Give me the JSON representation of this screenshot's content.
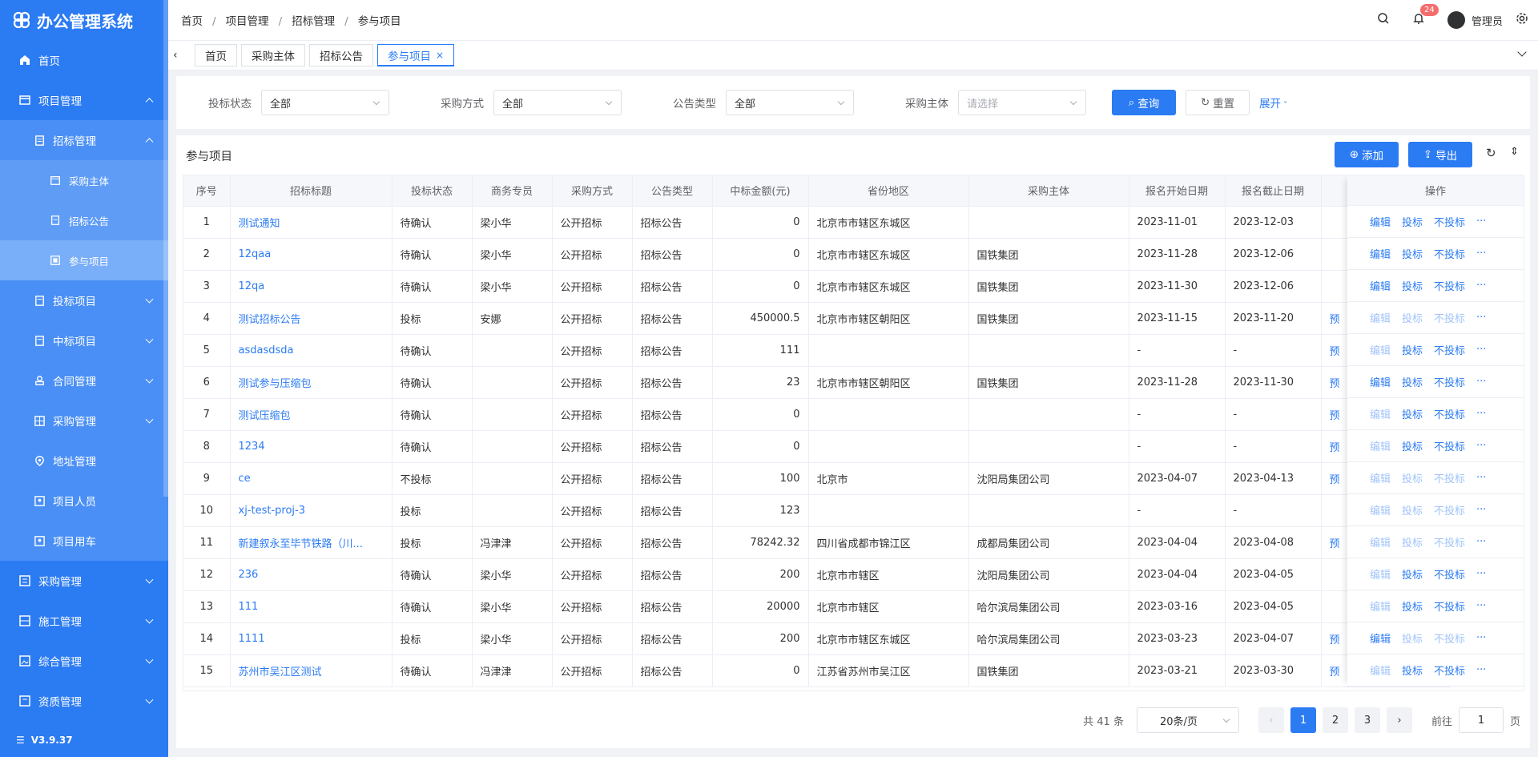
{
  "app": {
    "title": "办公管理系统",
    "version": "V3.9.37"
  },
  "sidebar": {
    "items": [
      {
        "label": "首页"
      },
      {
        "label": "项目管理"
      },
      {
        "label": "招标管理"
      },
      {
        "label": "采购主体"
      },
      {
        "label": "招标公告"
      },
      {
        "label": "参与项目"
      },
      {
        "label": "投标项目"
      },
      {
        "label": "中标项目"
      },
      {
        "label": "合同管理"
      },
      {
        "label": "采购管理"
      },
      {
        "label": "地址管理"
      },
      {
        "label": "项目人员"
      },
      {
        "label": "项目用车"
      },
      {
        "label": "采购管理"
      },
      {
        "label": "施工管理"
      },
      {
        "label": "综合管理"
      },
      {
        "label": "资质管理"
      }
    ]
  },
  "breadcrumb": [
    "首页",
    "项目管理",
    "招标管理",
    "参与项目"
  ],
  "breadcrumb_sep": "/",
  "header": {
    "notification_count": "24",
    "user": "管理员"
  },
  "tabs": [
    "首页",
    "采购主体",
    "招标公告",
    "参与项目"
  ],
  "tab_close": "×",
  "filters": [
    {
      "label": "投标状态",
      "value": "全部"
    },
    {
      "label": "采购方式",
      "value": "全部"
    },
    {
      "label": "公告类型",
      "value": "全部"
    },
    {
      "label": "采购主体",
      "placeholder": "请选择"
    }
  ],
  "buttons": {
    "query": "查询",
    "reset": "重置",
    "expand": "展开",
    "add": "添加",
    "export": "导出"
  },
  "section_title": "参与项目",
  "table": {
    "headers": [
      "序号",
      "招标标题",
      "投标状态",
      "商务专员",
      "采购方式",
      "公告类型",
      "中标金额(元)",
      "省份地区",
      "采购主体",
      "报名开始日期",
      "报名截止日期",
      ""
    ],
    "op_header": "操作",
    "hidden_col_text": "预",
    "rows": [
      {
        "no": "1",
        "title": "测试通知",
        "status": "待确认",
        "person": "梁小华",
        "method": "公开招标",
        "type": "招标公告",
        "amount": "0",
        "region": "北京市市辖区东城区",
        "buyer": "",
        "start": "2023-11-01",
        "end": "2023-12-03",
        "pre": "",
        "ops": [
          true,
          true,
          true
        ]
      },
      {
        "no": "2",
        "title": "12qaa",
        "status": "待确认",
        "person": "梁小华",
        "method": "公开招标",
        "type": "招标公告",
        "amount": "0",
        "region": "北京市市辖区东城区",
        "buyer": "国铁集团",
        "start": "2023-11-28",
        "end": "2023-12-06",
        "pre": "",
        "ops": [
          true,
          true,
          true
        ]
      },
      {
        "no": "3",
        "title": "12qa",
        "status": "待确认",
        "person": "梁小华",
        "method": "公开招标",
        "type": "招标公告",
        "amount": "0",
        "region": "北京市市辖区东城区",
        "buyer": "国铁集团",
        "start": "2023-11-30",
        "end": "2023-12-06",
        "pre": "",
        "ops": [
          true,
          true,
          true
        ]
      },
      {
        "no": "4",
        "title": "测试招标公告",
        "status": "投标",
        "person": "安娜",
        "method": "公开招标",
        "type": "招标公告",
        "amount": "450000.5",
        "region": "北京市市辖区朝阳区",
        "buyer": "国铁集团",
        "start": "2023-11-15",
        "end": "2023-11-20",
        "pre": "预",
        "ops": [
          false,
          false,
          false
        ]
      },
      {
        "no": "5",
        "title": "asdasdsda",
        "status": "待确认",
        "person": "",
        "method": "公开招标",
        "type": "招标公告",
        "amount": "111",
        "region": "",
        "buyer": "",
        "start": "-",
        "end": "-",
        "pre": "预",
        "ops": [
          false,
          true,
          true
        ]
      },
      {
        "no": "6",
        "title": "测试参与压缩包",
        "status": "待确认",
        "person": "",
        "method": "公开招标",
        "type": "招标公告",
        "amount": "23",
        "region": "北京市市辖区朝阳区",
        "buyer": "国铁集团",
        "start": "2023-11-28",
        "end": "2023-11-30",
        "pre": "预",
        "ops": [
          true,
          true,
          true
        ]
      },
      {
        "no": "7",
        "title": "测试压缩包",
        "status": "待确认",
        "person": "",
        "method": "公开招标",
        "type": "招标公告",
        "amount": "0",
        "region": "",
        "buyer": "",
        "start": "-",
        "end": "-",
        "pre": "预",
        "ops": [
          false,
          true,
          true
        ]
      },
      {
        "no": "8",
        "title": "1234",
        "status": "待确认",
        "person": "",
        "method": "公开招标",
        "type": "招标公告",
        "amount": "0",
        "region": "",
        "buyer": "",
        "start": "-",
        "end": "-",
        "pre": "预",
        "ops": [
          false,
          true,
          true
        ]
      },
      {
        "no": "9",
        "title": "ce",
        "status": "不投标",
        "person": "",
        "method": "公开招标",
        "type": "招标公告",
        "amount": "100",
        "region": "北京市",
        "buyer": "沈阳局集团公司",
        "start": "2023-04-07",
        "end": "2023-04-13",
        "pre": "预",
        "ops": [
          false,
          false,
          false
        ]
      },
      {
        "no": "10",
        "title": "xj-test-proj-3",
        "status": "投标",
        "person": "",
        "method": "公开招标",
        "type": "招标公告",
        "amount": "123",
        "region": "",
        "buyer": "",
        "start": "-",
        "end": "-",
        "pre": "",
        "ops": [
          false,
          false,
          false
        ]
      },
      {
        "no": "11",
        "title": "新建叙永至毕节铁路（川...",
        "status": "投标",
        "person": "冯津津",
        "method": "公开招标",
        "type": "招标公告",
        "amount": "78242.32",
        "region": "四川省成都市锦江区",
        "buyer": "成都局集团公司",
        "start": "2023-04-04",
        "end": "2023-04-08",
        "pre": "预",
        "ops": [
          false,
          false,
          false
        ]
      },
      {
        "no": "12",
        "title": "236",
        "status": "待确认",
        "person": "梁小华",
        "method": "公开招标",
        "type": "招标公告",
        "amount": "200",
        "region": "北京市市辖区",
        "buyer": "沈阳局集团公司",
        "start": "2023-04-04",
        "end": "2023-04-05",
        "pre": "",
        "ops": [
          false,
          true,
          true
        ]
      },
      {
        "no": "13",
        "title": "111",
        "status": "待确认",
        "person": "梁小华",
        "method": "公开招标",
        "type": "招标公告",
        "amount": "20000",
        "region": "北京市市辖区",
        "buyer": "哈尔滨局集团公司",
        "start": "2023-03-16",
        "end": "2023-04-05",
        "pre": "",
        "ops": [
          false,
          true,
          true
        ]
      },
      {
        "no": "14",
        "title": "1111",
        "status": "投标",
        "person": "梁小华",
        "method": "公开招标",
        "type": "招标公告",
        "amount": "200",
        "region": "北京市市辖区东城区",
        "buyer": "哈尔滨局集团公司",
        "start": "2023-03-23",
        "end": "2023-04-07",
        "pre": "预",
        "ops": [
          true,
          false,
          false
        ]
      },
      {
        "no": "15",
        "title": "苏州市吴江区测试",
        "status": "待确认",
        "person": "冯津津",
        "method": "公开招标",
        "type": "招标公告",
        "amount": "0",
        "region": "江苏省苏州市吴江区",
        "buyer": "国铁集团",
        "start": "2023-03-21",
        "end": "2023-03-30",
        "pre": "预",
        "ops": [
          false,
          true,
          true
        ]
      }
    ],
    "op_labels": [
      "编辑",
      "投标",
      "不投标",
      "···"
    ]
  },
  "pagination": {
    "total": "共 41 条",
    "page_size": "20条/页",
    "pages": [
      "1",
      "2",
      "3"
    ],
    "current": "1",
    "goto_label": "前往",
    "goto_value": "1",
    "page_unit": "页"
  },
  "colors": {
    "primary": "#2b7bf3",
    "sidebar": "#2b7bf3",
    "disabled_link": "#a0c4fa",
    "badge": "#f56c6c"
  }
}
